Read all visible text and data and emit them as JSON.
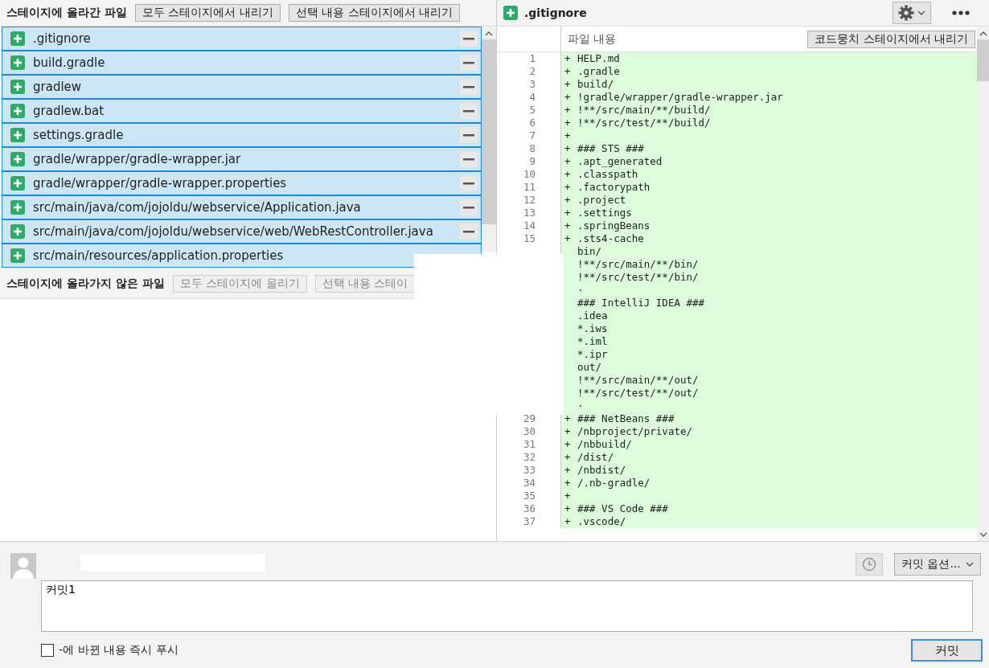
{
  "staged": {
    "title": "스테이지에 올라간 파일",
    "buttons": [
      "모두 스테이지에서 내리기",
      "선택 내용 스테이지에서 내리기"
    ],
    "files": [
      {
        "name": ".gitignore",
        "selected": true
      },
      {
        "name": "build.gradle",
        "selected": true
      },
      {
        "name": "gradlew",
        "selected": true
      },
      {
        "name": "gradlew.bat",
        "selected": true
      },
      {
        "name": "settings.gradle",
        "selected": true
      },
      {
        "name": "gradle/wrapper/gradle-wrapper.jar",
        "selected": true
      },
      {
        "name": "gradle/wrapper/gradle-wrapper.properties",
        "selected": true
      },
      {
        "name": "src/main/java/com/jojoldu/webservice/Application.java",
        "selected": true
      },
      {
        "name": "src/main/java/com/jojoldu/webservice/web/WebRestController.java",
        "selected": true
      },
      {
        "name": "src/main/resources/application.properties",
        "selected": true,
        "unstage_button": false
      }
    ]
  },
  "unstaged": {
    "title": "스테이지에 올라가지 않은 파일",
    "buttons": [
      "모두 스테이지에 올리기",
      "선택 내용 스테이"
    ]
  },
  "diff": {
    "file": ".gitignore",
    "column_header": "파일 내용",
    "hunk_button": "코드뭉치 스테이지에서 내리기",
    "lines": [
      {
        "number": "1",
        "marker": "+",
        "text": "HELP.md"
      },
      {
        "number": "2",
        "marker": "+",
        "text": ".gradle"
      },
      {
        "number": "3",
        "marker": "+",
        "text": "build/"
      },
      {
        "number": "4",
        "marker": "+",
        "text": "!gradle/wrapper/gradle-wrapper.jar"
      },
      {
        "number": "5",
        "marker": "+",
        "text": "!**/src/main/**/build/"
      },
      {
        "number": "6",
        "marker": "+",
        "text": "!**/src/test/**/build/"
      },
      {
        "number": "7",
        "marker": "+"
      },
      {
        "number": "8",
        "marker": "+",
        "text": "### STS ###"
      },
      {
        "number": "9",
        "marker": "+",
        "text": ".apt_generated"
      },
      {
        "number": "10",
        "marker": "+",
        "text": ".classpath"
      },
      {
        "number": "11",
        "marker": "+",
        "text": ".factorypath"
      },
      {
        "number": "12",
        "marker": "+",
        "text": ".project"
      },
      {
        "number": "13",
        "marker": "+",
        "text": ".settings"
      },
      {
        "number": "14",
        "marker": "+",
        "text": ".springBeans"
      },
      {
        "number": "15",
        "marker": "+",
        "text": ".sts4-cache"
      },
      {
        "text": "bin/"
      },
      {
        "text": "!**/src/main/**/bin/"
      },
      {
        "text": "!**/src/test/**/bin/"
      },
      {
        "text": "·"
      },
      {
        "text": "### IntelliJ IDEA ###"
      },
      {
        "text": ".idea"
      },
      {
        "text": "*.iws"
      },
      {
        "text": "*.iml"
      },
      {
        "text": "*.ipr"
      },
      {
        "text": "out/"
      },
      {
        "text": "!**/src/main/**/out/"
      },
      {
        "text": "!**/src/test/**/out/"
      },
      {
        "text": "·"
      },
      {
        "number": "29",
        "marker": "+",
        "text": "### NetBeans ###"
      },
      {
        "number": "30",
        "marker": "+",
        "text": "/nbproject/private/"
      },
      {
        "number": "31",
        "marker": "+",
        "text": "/nbbuild/"
      },
      {
        "number": "32",
        "marker": "+",
        "text": "/dist/"
      },
      {
        "number": "33",
        "marker": "+",
        "text": "/nbdist/"
      },
      {
        "number": "34",
        "marker": "+",
        "text": "/.nb-gradle/"
      },
      {
        "number": "35",
        "marker": "+"
      },
      {
        "number": "36",
        "marker": "+",
        "text": "### VS Code ###"
      },
      {
        "number": "37",
        "marker": "+",
        "text": ".vscode/"
      }
    ]
  },
  "commit": {
    "message": "커밋1",
    "options_button": "커밋 옵션...",
    "push_label": "-에 바뀐 내용 즉시 푸시",
    "push_checked": false,
    "commit_button": "커밋"
  }
}
